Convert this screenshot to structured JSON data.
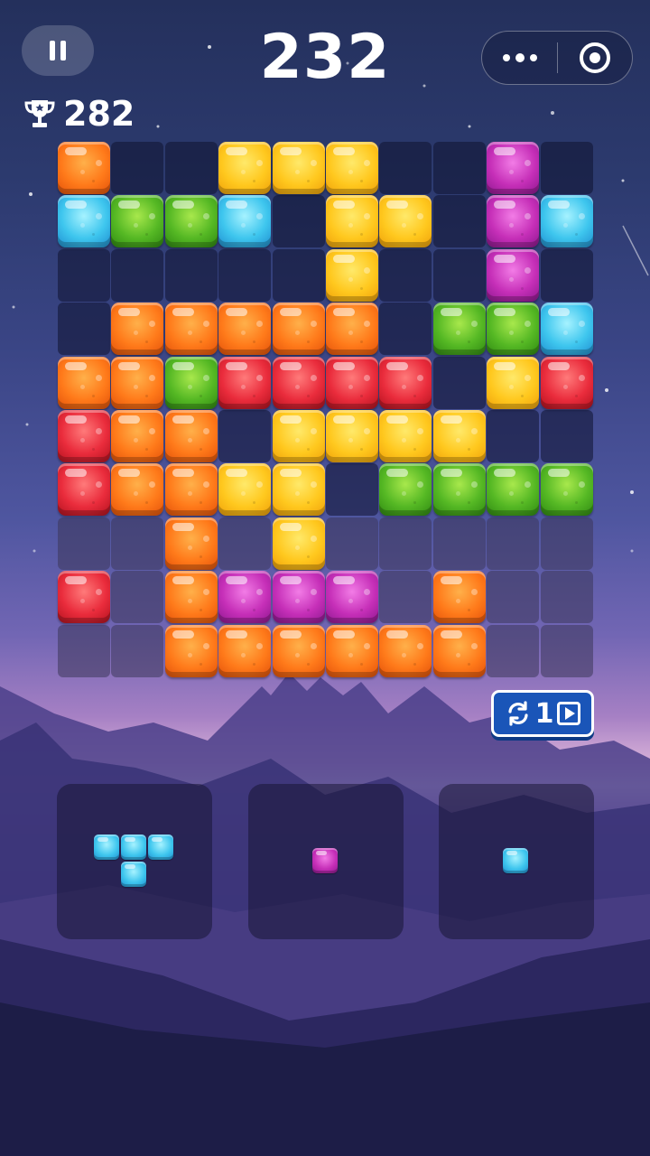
{
  "score": "232",
  "best_score": "282",
  "board": {
    "size": 10,
    "grid": [
      [
        "o",
        "",
        "",
        "y",
        "y",
        "y",
        "",
        "",
        "m",
        ""
      ],
      [
        "b",
        "g",
        "g",
        "b",
        "",
        "y",
        "y",
        "",
        "m",
        "b"
      ],
      [
        "",
        "",
        "",
        "",
        "",
        "y",
        "",
        "",
        "m",
        ""
      ],
      [
        "",
        "o",
        "o",
        "o",
        "o",
        "o",
        "",
        "g",
        "g",
        "b"
      ],
      [
        "o",
        "o",
        "g",
        "r",
        "r",
        "r",
        "r",
        "",
        "y",
        "r"
      ],
      [
        "r",
        "o",
        "o",
        "",
        "y",
        "y",
        "y",
        "y",
        "",
        ""
      ],
      [
        "r",
        "o",
        "o",
        "y",
        "y",
        "",
        "g",
        "g",
        "g",
        "g"
      ],
      [
        "",
        "",
        "o",
        "",
        "y",
        "",
        "",
        "",
        "",
        ""
      ],
      [
        "r",
        "",
        "o",
        "m",
        "m",
        "m",
        "",
        "o",
        "",
        ""
      ],
      [
        "",
        "",
        "o",
        "o",
        "o",
        "o",
        "o",
        "o",
        "",
        ""
      ]
    ]
  },
  "colors": {
    "o": "#ff7a1a",
    "y": "#ffc81e",
    "g": "#55b824",
    "b": "#3ec6ee",
    "m": "#c62fb8",
    "r": "#ea2c3c"
  },
  "refresh": {
    "count": "1",
    "icon": "refresh-icon",
    "video_icon": "play-video-icon"
  },
  "pieces": [
    {
      "color": "b",
      "cells": [
        [
          0,
          0
        ],
        [
          1,
          0
        ],
        [
          2,
          0
        ],
        [
          1,
          1
        ]
      ]
    },
    {
      "color": "m",
      "cells": [
        [
          0,
          0
        ]
      ]
    },
    {
      "color": "b",
      "cells": [
        [
          0,
          0
        ]
      ]
    }
  ],
  "icons": {
    "pause": "pause-icon",
    "trophy": "trophy-icon",
    "more": "more-dots-icon",
    "close": "close-miniprogram-icon"
  }
}
